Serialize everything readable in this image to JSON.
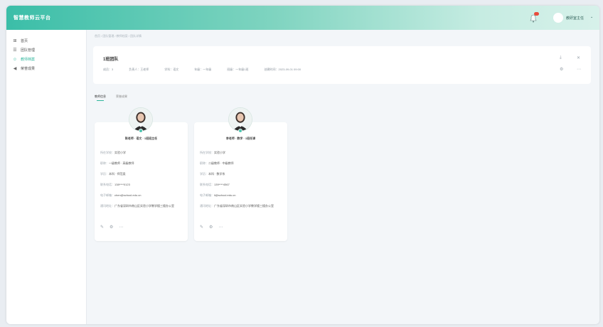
{
  "app": {
    "title": "智慧教师云平台"
  },
  "header": {
    "user_name": "教研室主任",
    "caret": "⌄"
  },
  "sidebar": {
    "items": [
      {
        "label": "首页",
        "icon": "⊞"
      },
      {
        "label": "团队管理",
        "icon": "☰"
      },
      {
        "label": "教师档案",
        "icon": "☺",
        "active": true
      },
      {
        "label": "荣誉成果",
        "icon": "◀"
      }
    ]
  },
  "breadcrumb": "首页 / 团队管理 / 教师档案 / 团队详情",
  "team": {
    "title": "1班团队",
    "fields": [
      "成员：3",
      "负责人：王老师",
      "学科：语文",
      "年级：一年级",
      "班级：一年级1班",
      "创建时间：2023-09-01 09:00"
    ],
    "actions": [
      "⤓",
      "✕",
      "⚙",
      "⋯"
    ]
  },
  "tabs": [
    "教师信息",
    "荣誉成果"
  ],
  "teachers": [
    {
      "name_row": "陈老师 · 语文 · 1班班主任",
      "lines": [
        {
          "label": "所在学校：",
          "value": "实验小学"
        },
        {
          "label": "职称：",
          "value": "一级教师 · 高级教师"
        },
        {
          "label": "学历：",
          "value": "本科 · 师范类"
        },
        {
          "label": "联系电话：",
          "value": "138****0123"
        },
        {
          "label": "电子邮箱：",
          "value": "chen@school.edu.cn"
        },
        {
          "label": "通讯地址：",
          "value": "广东省深圳市南山区实验小学教学楼三楼办公室"
        }
      ],
      "icons": [
        "✎",
        "⚙",
        "⋯"
      ]
    },
    {
      "name_row": "李老师 · 数学 · 1班任课",
      "lines": [
        {
          "label": "所在学校：",
          "value": "实验小学"
        },
        {
          "label": "职称：",
          "value": "二级教师 · 中级教师"
        },
        {
          "label": "学历：",
          "value": "本科 · 数学系"
        },
        {
          "label": "联系电话：",
          "value": "139****4567"
        },
        {
          "label": "电子邮箱：",
          "value": "li@school.edu.cn"
        },
        {
          "label": "通讯地址：",
          "value": "广东省深圳市南山区实验小学教学楼三楼办公室"
        }
      ],
      "icons": [
        "✎",
        "⚙",
        "⋯"
      ]
    }
  ],
  "colors": {
    "accent": "#2fb69c",
    "header_start": "#3bbea8",
    "badge": "#e94b3c"
  }
}
